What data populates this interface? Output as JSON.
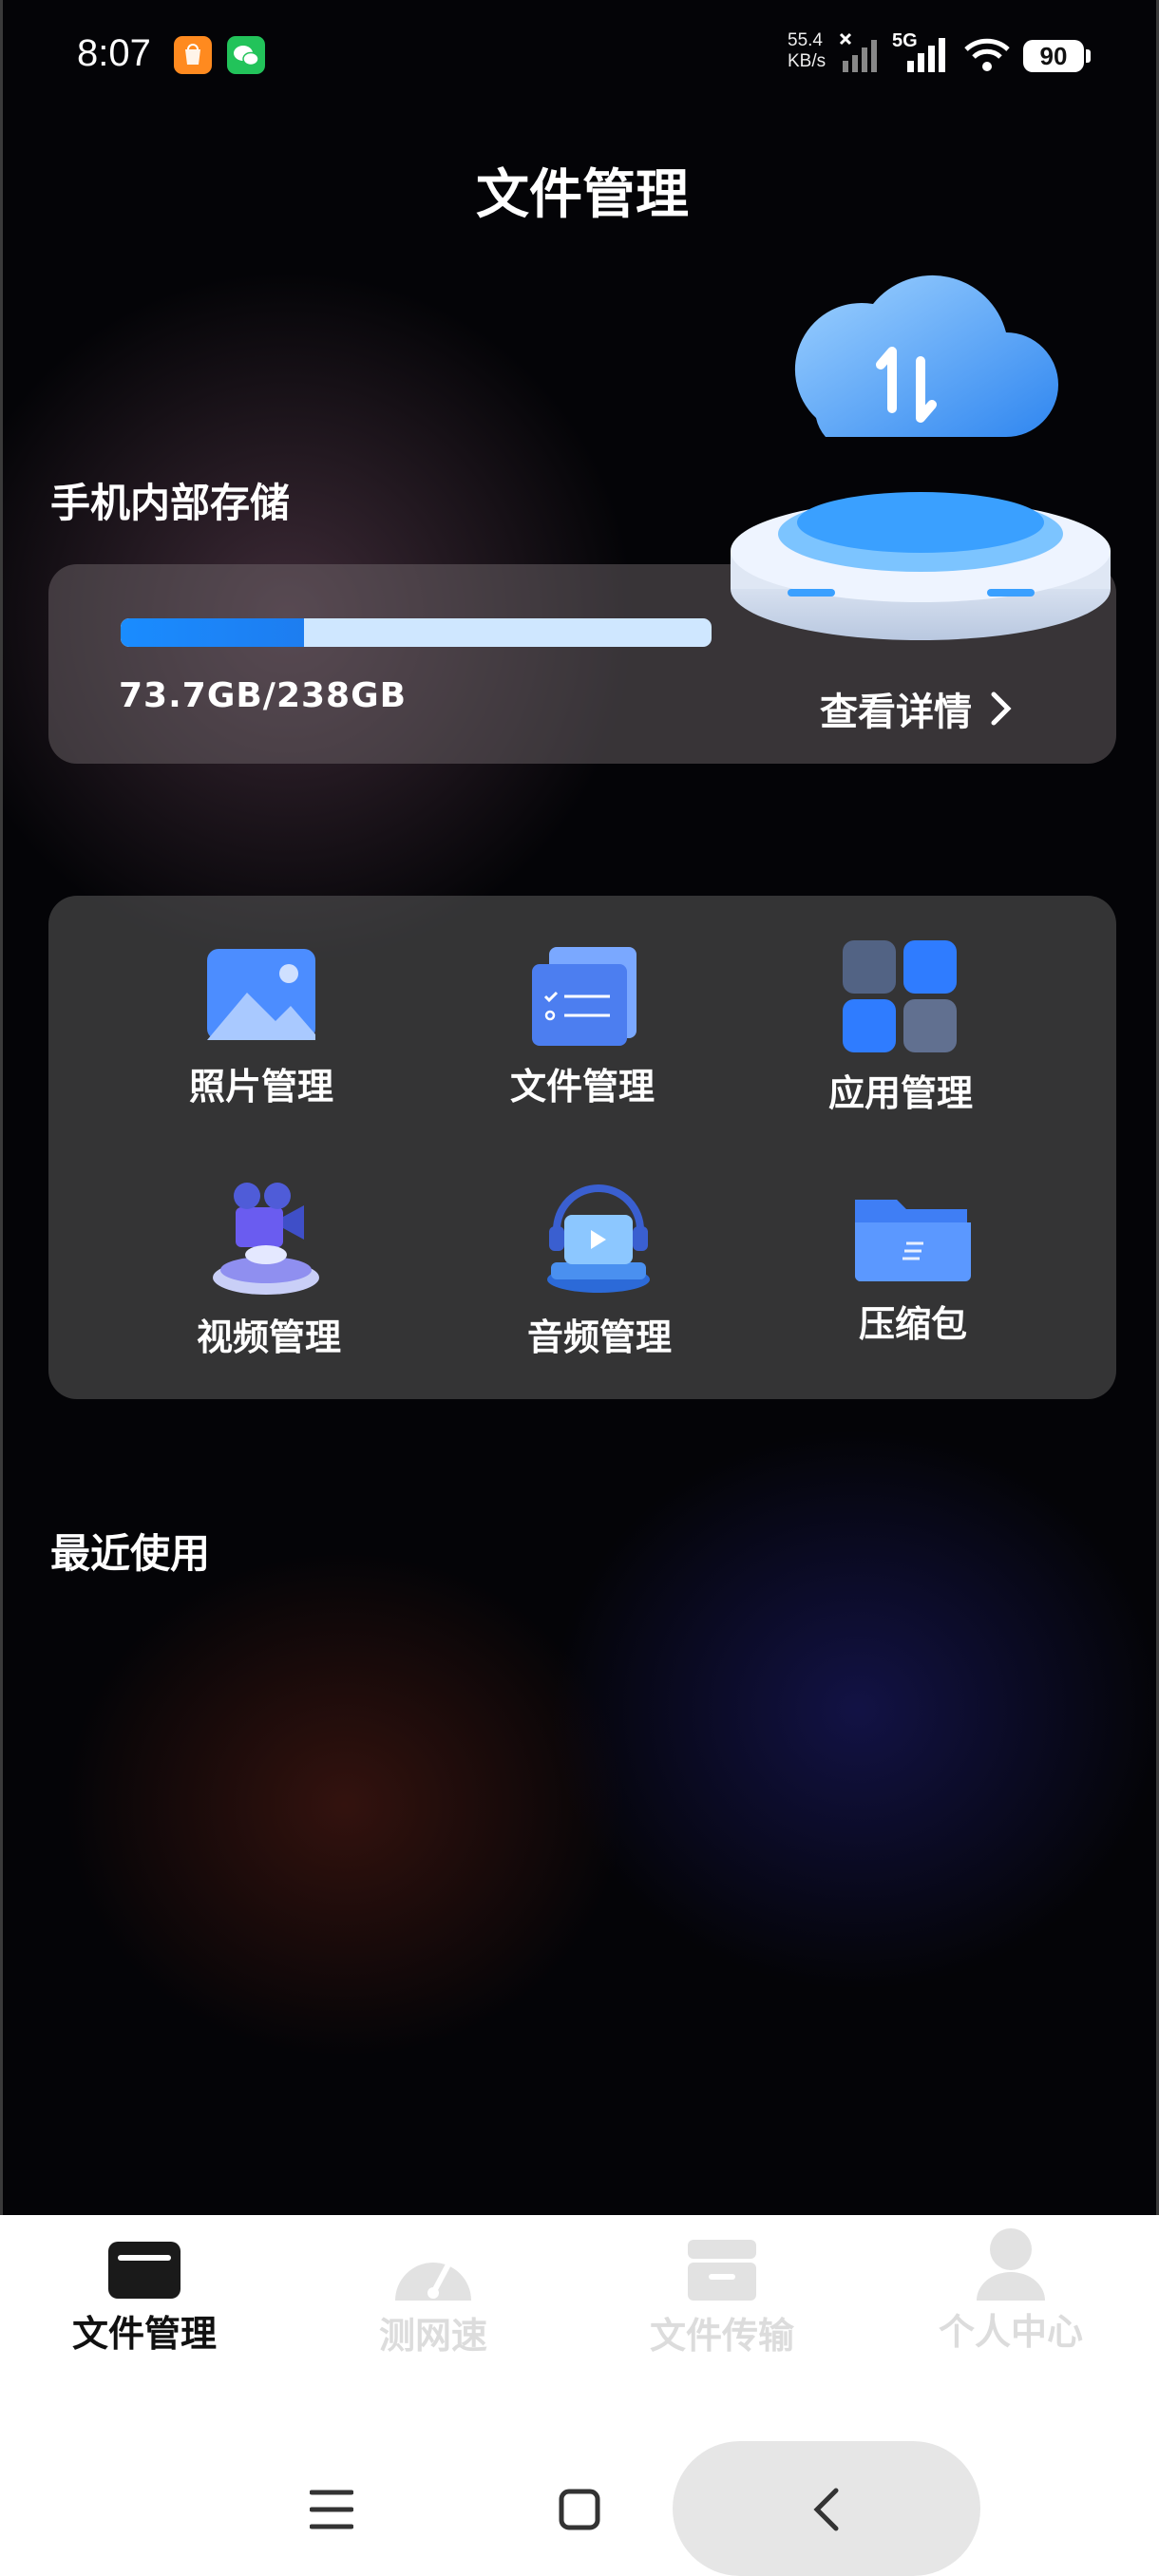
{
  "status_bar": {
    "time": "8:07",
    "speed_value": "55.4",
    "speed_unit": "KB/s",
    "network": "5G",
    "battery": "90"
  },
  "header": {
    "title": "文件管理"
  },
  "storage": {
    "section_title": "手机内部存储",
    "usage_text": "73.7GB/238GB",
    "used_fraction": 0.31,
    "details_label": "查看详情"
  },
  "categories": [
    {
      "label": "照片管理",
      "icon": "photo-icon"
    },
    {
      "label": "文件管理",
      "icon": "document-icon"
    },
    {
      "label": "应用管理",
      "icon": "apps-icon"
    },
    {
      "label": "视频管理",
      "icon": "video-icon"
    },
    {
      "label": "音频管理",
      "icon": "audio-icon"
    },
    {
      "label": "压缩包",
      "icon": "archive-folder-icon"
    }
  ],
  "recent": {
    "section_title": "最近使用"
  },
  "tabs": [
    {
      "label": "文件管理",
      "icon": "folder-icon",
      "active": true
    },
    {
      "label": "测网速",
      "icon": "speedometer-icon",
      "active": false
    },
    {
      "label": "文件传输",
      "icon": "transfer-box-icon",
      "active": false
    },
    {
      "label": "个人中心",
      "icon": "person-icon",
      "active": false
    }
  ],
  "colors": {
    "accent_blue": "#1a8cff",
    "progress_track": "#cfe7ff",
    "active_tab": "#111111",
    "inactive_tab": "#dcdcdc"
  }
}
